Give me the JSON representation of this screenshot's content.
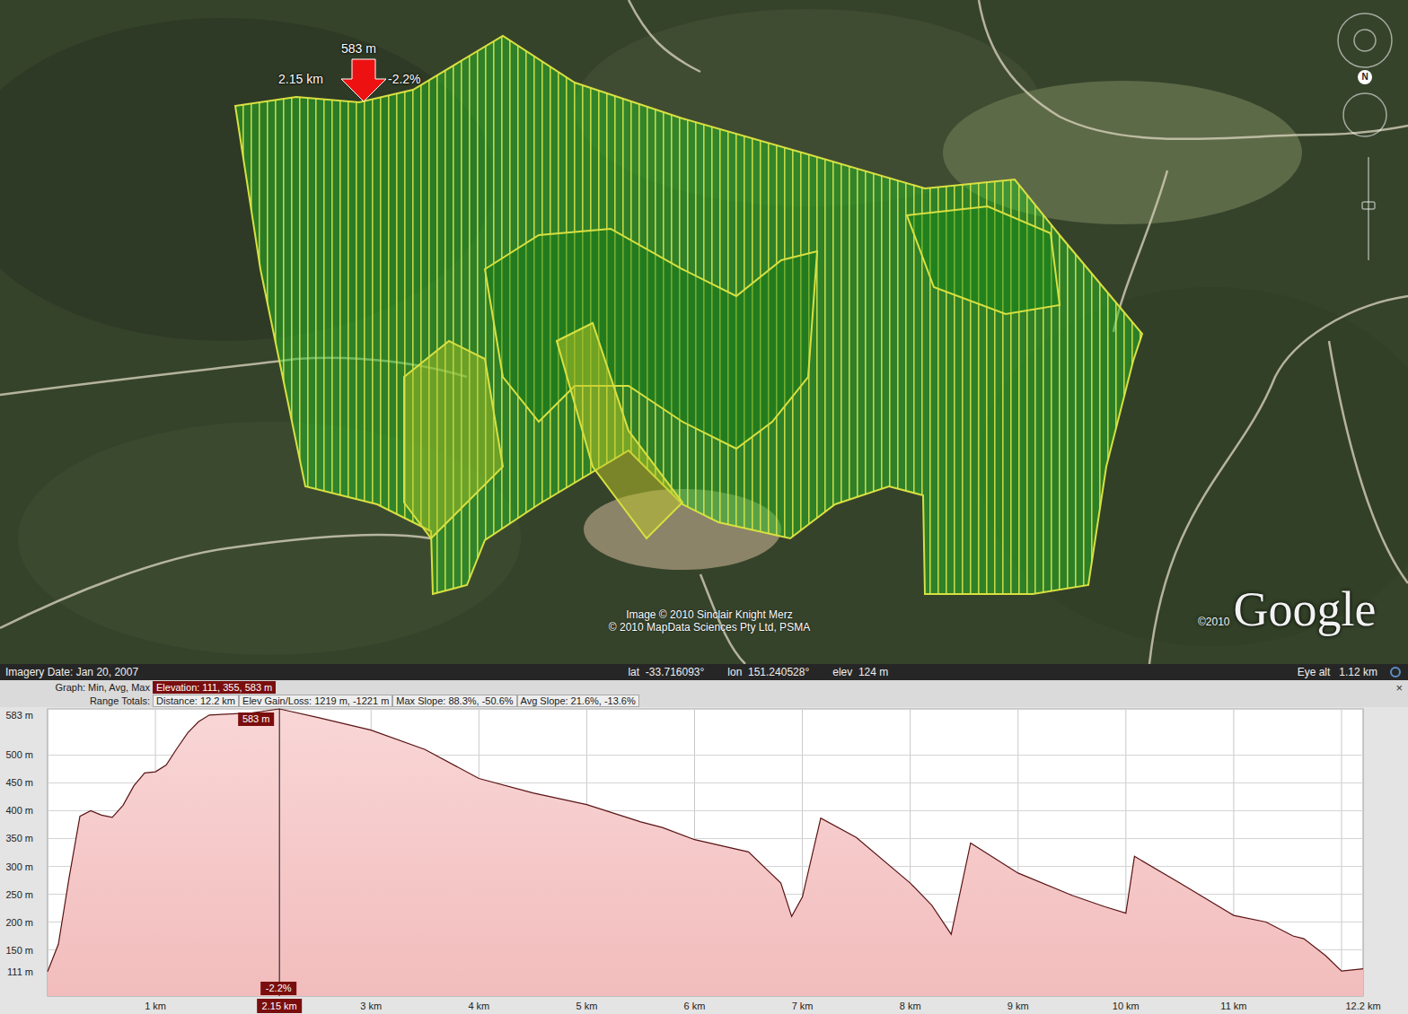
{
  "map": {
    "marker": {
      "elevation": "583 m",
      "distance": "2.15 km",
      "slope": "-2.2%"
    },
    "credits": [
      "Image © 2010 Sinclair Knight Merz",
      "© 2010 MapData Sciences Pty Ltd, PSMA"
    ],
    "logo_copyright": "©2010",
    "logo": "Google",
    "compass": "N"
  },
  "status_bar": {
    "imagery_date": "Imagery Date: Jan 20, 2007",
    "lat_label": "lat",
    "lat": "-33.716093°",
    "lon_label": "lon",
    "lon": "151.240528°",
    "elev_label": "elev",
    "elev": "124 m",
    "eye_alt_label": "Eye alt",
    "eye_alt": "1.12 km"
  },
  "graph_header": {
    "graph_label": "Graph: Min, Avg, Max",
    "graph_selected": "Elevation: 111, 355, 583 m",
    "range_label": "Range Totals:",
    "totals": [
      "Distance: 12.2 km",
      "Elev Gain/Loss: 1219 m, -1221 m",
      "Max Slope: 88.3%, -50.6%",
      "Avg Slope: 21.6%, -13.6%"
    ],
    "close": "×"
  },
  "chart": {
    "y_ticks": [
      {
        "label": "583 m",
        "value": 583
      },
      {
        "label": "500 m",
        "value": 500
      },
      {
        "label": "450 m",
        "value": 450
      },
      {
        "label": "400 m",
        "value": 400
      },
      {
        "label": "350 m",
        "value": 350
      },
      {
        "label": "300 m",
        "value": 300
      },
      {
        "label": "250 m",
        "value": 250
      },
      {
        "label": "200 m",
        "value": 200
      },
      {
        "label": "150 m",
        "value": 150
      },
      {
        "label": "111 m",
        "value": 111
      }
    ],
    "x_ticks": [
      {
        "label": "1 km",
        "value": 1
      },
      {
        "label": "3 km",
        "value": 3
      },
      {
        "label": "4 km",
        "value": 4
      },
      {
        "label": "5 km",
        "value": 5
      },
      {
        "label": "6 km",
        "value": 6
      },
      {
        "label": "7 km",
        "value": 7
      },
      {
        "label": "8 km",
        "value": 8
      },
      {
        "label": "9 km",
        "value": 9
      },
      {
        "label": "10 km",
        "value": 10
      },
      {
        "label": "11 km",
        "value": 11
      },
      {
        "label": "12.2 km",
        "value": 12.2
      }
    ],
    "cursor": {
      "distance": 2.15,
      "distance_label": "2.15 km",
      "elevation_label": "583 m",
      "slope_label": "-2.2%"
    },
    "series": [
      {
        "name": "Elevation",
        "distances_km": [
          0,
          0.1,
          0.2,
          0.3,
          0.4,
          0.5,
          0.6,
          0.7,
          0.8,
          0.9,
          1.0,
          1.1,
          1.2,
          1.3,
          1.4,
          1.5,
          1.7,
          1.9,
          2.15,
          2.5,
          3.0,
          3.5,
          4.0,
          4.5,
          5.0,
          5.5,
          5.7,
          6.0,
          6.5,
          6.8,
          6.9,
          7.0,
          7.17,
          7.5,
          8.0,
          8.2,
          8.38,
          8.56,
          9.0,
          9.5,
          9.8,
          10.0,
          10.08,
          10.5,
          11.0,
          11.3,
          11.55,
          11.65,
          11.85,
          12.0,
          12.2
        ],
        "elevations_m": [
          111,
          160,
          280,
          390,
          400,
          392,
          388,
          410,
          445,
          468,
          470,
          482,
          512,
          540,
          560,
          572,
          574,
          576,
          583,
          568,
          545,
          510,
          458,
          432,
          411,
          380,
          370,
          348,
          326,
          270,
          210,
          245,
          387,
          352,
          270,
          230,
          178,
          342,
          288,
          248,
          228,
          216,
          318,
          270,
          212,
          200,
          175,
          170,
          140,
          112,
          116
        ]
      }
    ]
  }
}
